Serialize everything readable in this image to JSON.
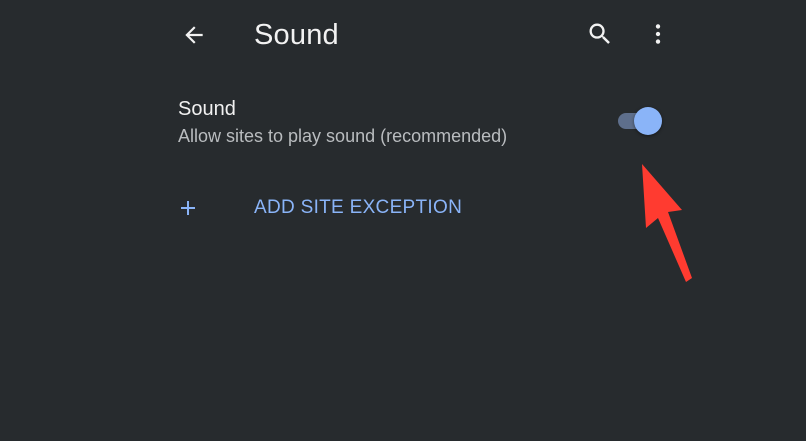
{
  "header": {
    "title": "Sound",
    "back_icon": "arrow-back-icon",
    "search_icon": "search-icon",
    "more_icon": "more-vert-icon"
  },
  "setting": {
    "title": "Sound",
    "summary": "Allow sites to play sound (recommended)",
    "enabled": true
  },
  "add_exception": {
    "icon": "plus-icon",
    "label": "ADD SITE EXCEPTION"
  },
  "annotation": {
    "icon": "red-arrow-icon"
  },
  "colors": {
    "background": "#272b2e",
    "accent": "#8ab4f8",
    "toggle_track": "#5e6f8c",
    "annotation": "#ff3b30"
  }
}
